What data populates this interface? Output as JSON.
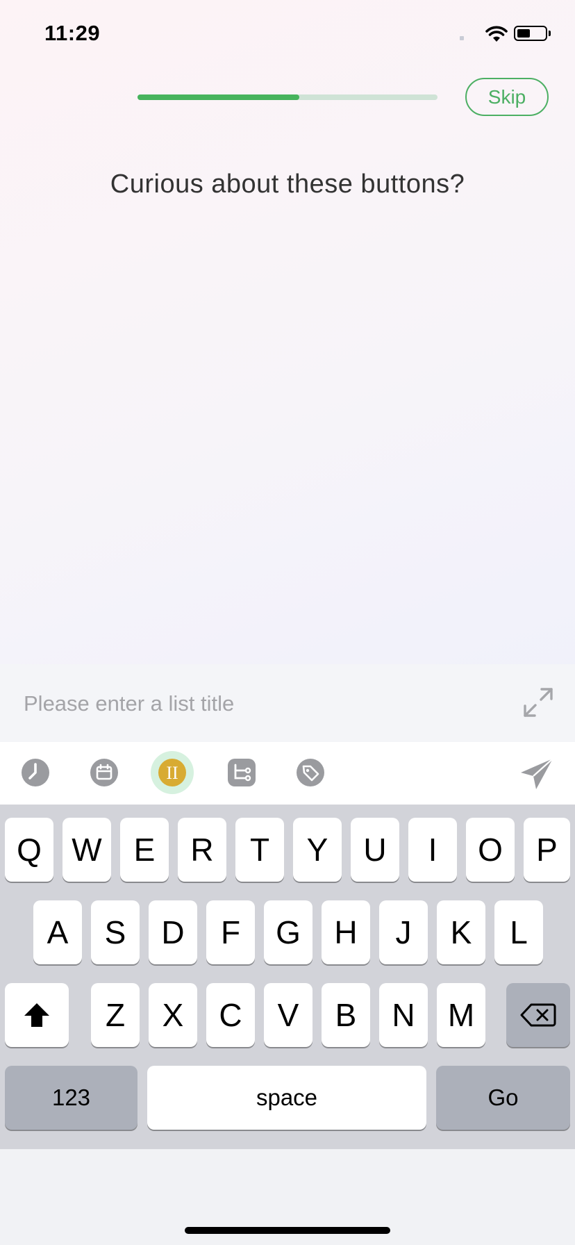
{
  "status_bar": {
    "time": "11:29",
    "battery_level": 0.55
  },
  "onboarding": {
    "progress": 0.54,
    "skip_label": "Skip",
    "title": "Curious about these buttons?"
  },
  "input": {
    "placeholder": "Please enter a list title",
    "value": ""
  },
  "toolbar": {
    "icons": [
      "clock-icon",
      "calendar-icon",
      "priority-icon",
      "subtask-icon",
      "tag-icon",
      "send-icon"
    ],
    "priority_label": "II"
  },
  "colors": {
    "accent": "#47b35d",
    "priority": "#d8ab32"
  },
  "keyboard": {
    "row1": [
      "Q",
      "W",
      "E",
      "R",
      "T",
      "Y",
      "U",
      "I",
      "O",
      "P"
    ],
    "row2": [
      "A",
      "S",
      "D",
      "F",
      "G",
      "H",
      "J",
      "K",
      "L"
    ],
    "row3": [
      "Z",
      "X",
      "C",
      "V",
      "B",
      "N",
      "M"
    ],
    "numbers_label": "123",
    "space_label": "space",
    "go_label": "Go"
  }
}
